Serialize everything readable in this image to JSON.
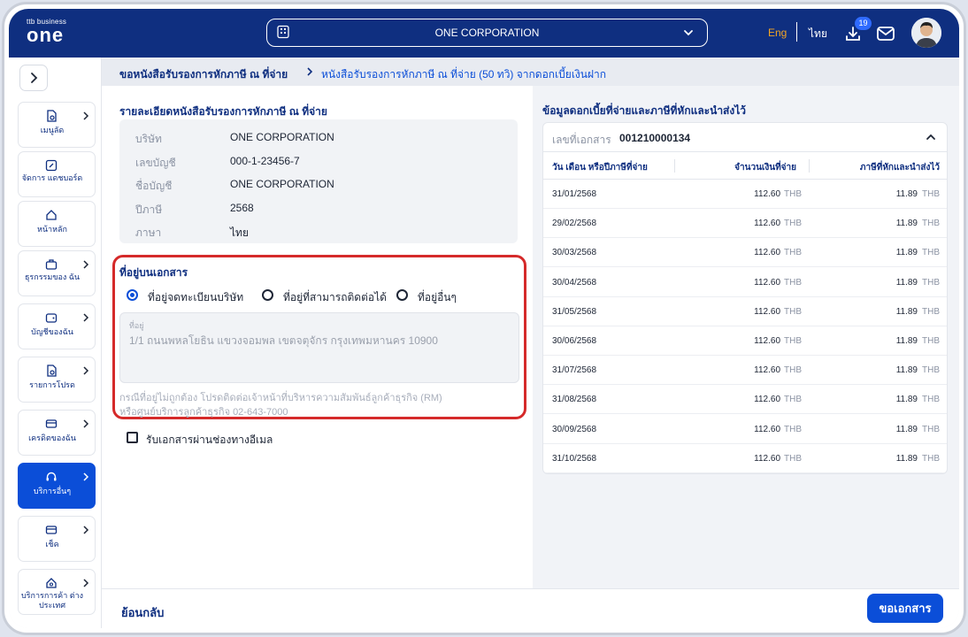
{
  "header": {
    "logo_small": "ttb business",
    "logo_big": "one",
    "company": "ONE CORPORATION",
    "lang_en": "Eng",
    "lang_th": "ไทย",
    "download_badge": "19"
  },
  "sidebar": {
    "items": [
      {
        "label": "เมนูลัด",
        "icon": "menu-shortcut-icon"
      },
      {
        "label": "จัดการ แดชบอร์ด",
        "icon": "dashboard-edit-icon"
      },
      {
        "label": "หน้าหลัก",
        "icon": "home-icon"
      },
      {
        "label": "ธุรกรรมของ ฉัน",
        "icon": "briefcase-icon"
      },
      {
        "label": "บัญชีของฉัน",
        "icon": "wallet-icon"
      },
      {
        "label": "รายการโปรด",
        "icon": "favorite-icon"
      },
      {
        "label": "เครดิตของฉัน",
        "icon": "credit-card-icon"
      },
      {
        "label": "บริการอื่นๆ",
        "icon": "headset-icon"
      },
      {
        "label": "เช็ค",
        "icon": "cheque-icon"
      },
      {
        "label": "บริการการค้า ต่างประเทศ",
        "icon": "trade-icon"
      }
    ]
  },
  "breadcrumb": {
    "parent": "ขอหนังสือรับรองการหักภาษี ณ ที่จ่าย",
    "current": "หนังสือรับรองการหักภาษี ณ ที่จ่าย (50 ทวิ) จากดอกเบี้ยเงินฝาก"
  },
  "details": {
    "title": "รายละเอียดหนังสือรับรองการหักภาษี ณ ที่จ่าย",
    "rows": [
      {
        "key": "บริษัท",
        "value": "ONE CORPORATION"
      },
      {
        "key": "เลขบัญชี",
        "value": "000-1-23456-7"
      },
      {
        "key": "ชื่อบัญชี",
        "value": "ONE CORPORATION"
      },
      {
        "key": "ปีภาษี",
        "value": "2568"
      },
      {
        "key": "ภาษา",
        "value": "ไทย"
      }
    ]
  },
  "address": {
    "title": "ที่อยู่บนเอกสาร",
    "options": [
      "ที่อยู่จดทะเบียนบริษัท",
      "ที่อยู่ที่สามารถติดต่อได้",
      "ที่อยู่อื่นๆ"
    ],
    "selected": 0,
    "field_label": "ที่อยู่",
    "field_value": "1/1 ถนนพหลโยธิน แขวงจอมพล เขตจตุจักร กรุงเทพมหานคร 10900",
    "note_line1": "กรณีที่อยู่ไม่ถูกต้อง โปรดติดต่อเจ้าหน้าที่บริหารความสัมพันธ์ลูกค้าธุรกิจ (RM)",
    "note_line2": "หรือศูนย์บริการลูกค้าธุรกิจ 02-643-7000"
  },
  "email_option": {
    "label": "รับเอกสารผ่านช่องทางอีเมล",
    "checked": false
  },
  "interest": {
    "title": "ข้อมูลดอกเบี้ยที่จ่ายและภาษีที่หักและนำส่งไว้",
    "doc_label": "เลขที่เอกสาร",
    "doc_number": "001210000134",
    "columns": [
      "วัน เดือน หรือปีภาษีที่จ่าย",
      "จำนวนเงินที่จ่าย",
      "ภาษีที่หักและนำส่งไว้"
    ],
    "currency": "THB",
    "rows": [
      {
        "date": "31/01/2568",
        "amount": "112.60",
        "tax": "11.89"
      },
      {
        "date": "29/02/2568",
        "amount": "112.60",
        "tax": "11.89"
      },
      {
        "date": "30/03/2568",
        "amount": "112.60",
        "tax": "11.89"
      },
      {
        "date": "30/04/2568",
        "amount": "112.60",
        "tax": "11.89"
      },
      {
        "date": "31/05/2568",
        "amount": "112.60",
        "tax": "11.89"
      },
      {
        "date": "30/06/2568",
        "amount": "112.60",
        "tax": "11.89"
      },
      {
        "date": "31/07/2568",
        "amount": "112.60",
        "tax": "11.89"
      },
      {
        "date": "31/08/2568",
        "amount": "112.60",
        "tax": "11.89"
      },
      {
        "date": "30/09/2568",
        "amount": "112.60",
        "tax": "11.89"
      },
      {
        "date": "31/10/2568",
        "amount": "112.60",
        "tax": "11.89"
      }
    ]
  },
  "footer": {
    "back": "ย้อนกลับ",
    "submit": "ขอเอกสาร"
  },
  "colors": {
    "brand_navy": "#0f2f80",
    "accent_blue": "#0b4ed8",
    "highlight_red": "#d52a2a",
    "lang_active": "#f5a623"
  }
}
